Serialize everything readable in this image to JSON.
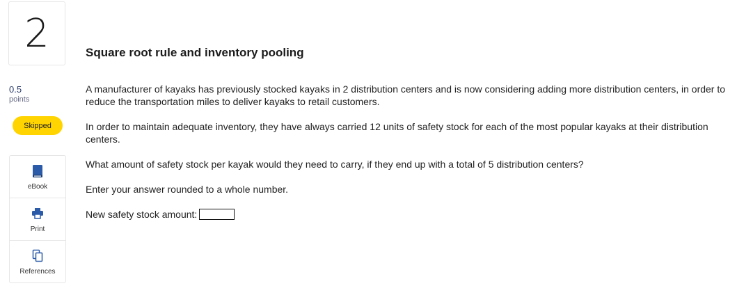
{
  "question": {
    "number": "2",
    "points_value": "0.5",
    "points_label": "points",
    "status": "Skipped",
    "title": "Square root rule and inventory pooling",
    "paragraphs": [
      "A manufacturer of kayaks has previously stocked kayaks in 2 distribution centers and is now considering adding more distribution centers, in order to reduce the transportation miles to deliver kayaks to retail customers.",
      "In order to maintain adequate inventory, they have always carried 12 units of safety stock for each of the most popular kayaks at their distribution centers.",
      "What amount of safety stock per kayak would they need to carry, if they end up with a total of 5 distribution centers?",
      "Enter your answer rounded to a whole number."
    ],
    "answer_label": "New safety stock amount:",
    "answer_value": ""
  },
  "tools": [
    {
      "label": "eBook",
      "icon": "book-icon"
    },
    {
      "label": "Print",
      "icon": "printer-icon"
    },
    {
      "label": "References",
      "icon": "copy-icon"
    }
  ],
  "colors": {
    "accent": "#2b5ba8",
    "badge": "#ffd400",
    "points_text": "#2d3d6e"
  }
}
